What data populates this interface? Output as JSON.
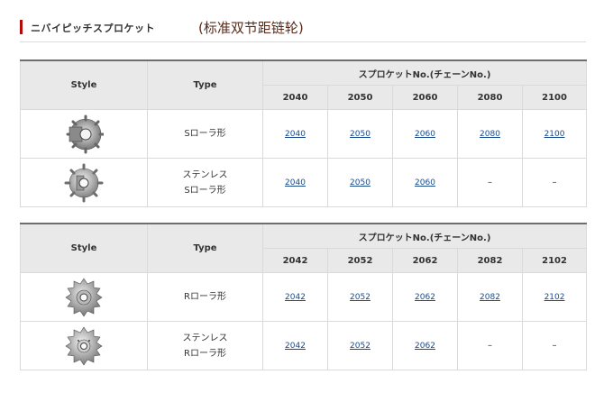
{
  "header": {
    "title": "ニバイピッチスプロケット",
    "subtitle": "(标准双节距链轮)"
  },
  "tables": [
    {
      "style_header": "Style",
      "type_header": "Type",
      "group_header": "スプロケットNo.(チェーンNo.)",
      "chains": [
        "2040",
        "2050",
        "2060",
        "2080",
        "2100"
      ],
      "rows": [
        {
          "icon": "sprocket-hub-icon",
          "type": [
            "Sローラ形"
          ],
          "cells": [
            "2040",
            "2050",
            "2060",
            "2080",
            "2100"
          ]
        },
        {
          "icon": "sprocket-stainless-icon",
          "type": [
            "ステンレス",
            "Sローラ形"
          ],
          "cells": [
            "2040",
            "2050",
            "2060",
            "–",
            "–"
          ]
        }
      ]
    },
    {
      "style_header": "Style",
      "type_header": "Type",
      "group_header": "スプロケットNo.(チェーンNo.)",
      "chains": [
        "2042",
        "2052",
        "2062",
        "2082",
        "2102"
      ],
      "rows": [
        {
          "icon": "sprocket-r-icon",
          "type": [
            "Rローラ形"
          ],
          "cells": [
            "2042",
            "2052",
            "2062",
            "2082",
            "2102"
          ]
        },
        {
          "icon": "sprocket-r-stainless-icon",
          "type": [
            "ステンレス",
            "Rローラ形"
          ],
          "cells": [
            "2042",
            "2052",
            "2062",
            "–",
            "–"
          ]
        }
      ]
    }
  ],
  "colors": {
    "accent": "#b50a0a",
    "link": "#1b4a8c",
    "header_bg": "#e9e9e9"
  }
}
